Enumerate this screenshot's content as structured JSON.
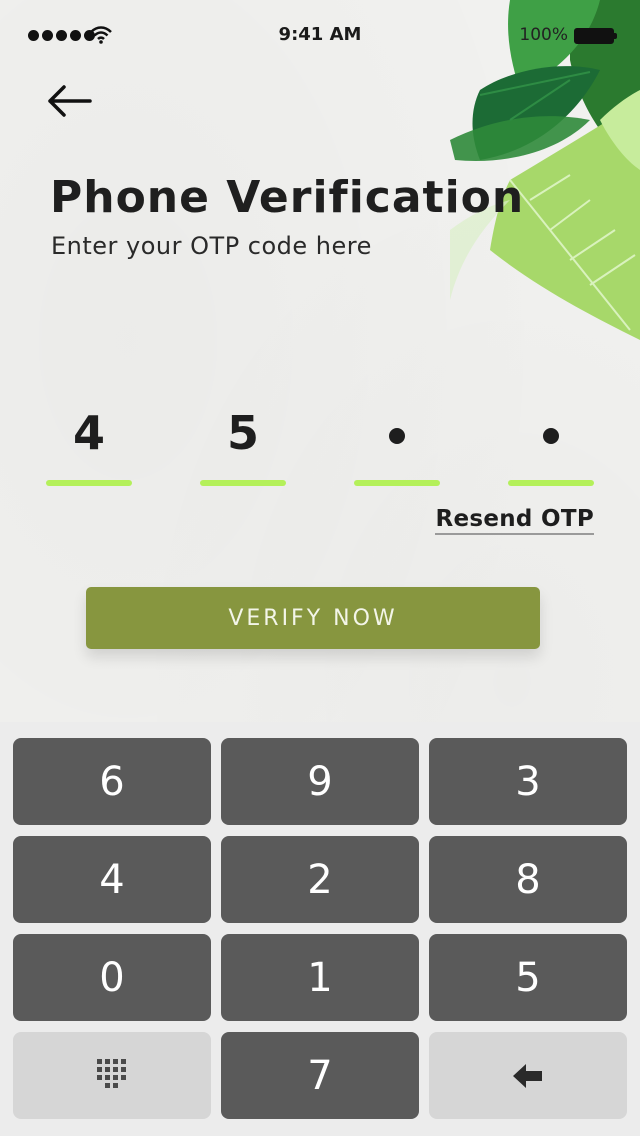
{
  "status_bar": {
    "time": "9:41 AM",
    "battery": "100%"
  },
  "header": {
    "title": "Phone Verification",
    "subtitle": "Enter your OTP code here"
  },
  "otp": {
    "digits": [
      "4",
      "5",
      "",
      ""
    ]
  },
  "actions": {
    "resend_label": "Resend OTP",
    "verify_label": "VERIFY NOW"
  },
  "keypad": {
    "keys": [
      "6",
      "9",
      "3",
      "4",
      "2",
      "8",
      "0",
      "1",
      "5",
      "7"
    ]
  },
  "colors": {
    "accent_line": "#b4f05a",
    "verify_button": "#87963f",
    "key_dark": "#5a5a5a",
    "key_light": "#d6d6d6",
    "leaf_dark": "#1f7a3a",
    "leaf_light": "#a7d86a"
  }
}
